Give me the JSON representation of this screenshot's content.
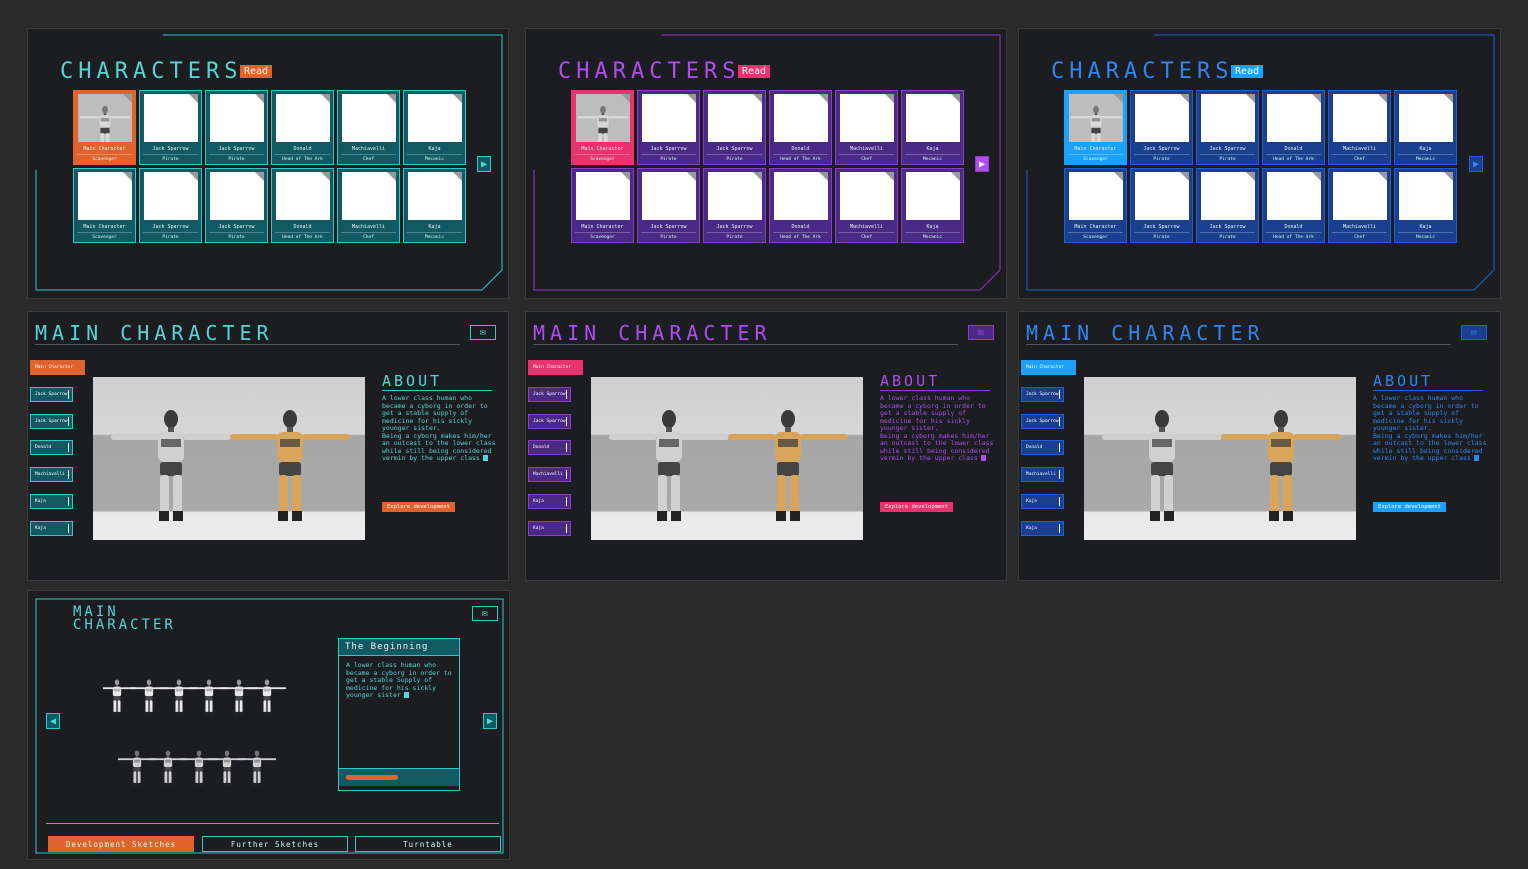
{
  "characters_screen": {
    "title": "CHARACTERS",
    "read_badge": "Read",
    "cards": [
      {
        "name": "Main Character",
        "role": "Scavenger"
      },
      {
        "name": "Jack Sparrow",
        "role": "Pirate"
      },
      {
        "name": "Jack Sparrow",
        "role": "Pirate"
      },
      {
        "name": "Donald",
        "role": "Head of The Ark"
      },
      {
        "name": "Machiavelli",
        "role": "Chef"
      },
      {
        "name": "Kaja",
        "role": "Mecanic"
      },
      {
        "name": "Main Character",
        "role": "Scavenger"
      },
      {
        "name": "Jack Sparrow",
        "role": "Pirate"
      },
      {
        "name": "Jack Sparrow",
        "role": "Pirate"
      },
      {
        "name": "Donald",
        "role": "Head of The Ark"
      },
      {
        "name": "Machiavelli",
        "role": "Chef"
      },
      {
        "name": "Kaja",
        "role": "Mecanic"
      }
    ],
    "next_arrow": "▶"
  },
  "main_character_screen": {
    "title": "MAIN CHARACTER",
    "close_icon": "✉",
    "side_buttons": [
      "Main Character",
      "Jack Sparrow",
      "Jack Sparrow",
      "Donald",
      "Machiavelli",
      "Kaja",
      "Kaja"
    ],
    "about_heading": "ABOUT",
    "about_text": "A lower class human who became a cyborg in order to get a stable supply of medicine for his sickly younger sister.\nBeing a cyborg makes him/her an outcast to the lower class while still being considered vermin by the upper class",
    "explore_button": "Explore development"
  },
  "sketch_screen": {
    "title_line1": "MAIN",
    "title_line2": "CHARACTER",
    "close_icon": "✉",
    "info_heading": "The Beginning",
    "info_text": "A lower class human who became a cyborg in order to get a stable Supply of medicine for his sickly younger sister",
    "prev_arrow": "◀",
    "next_arrow": "▶",
    "tabs": [
      "Development Sketches",
      "Further Sketches",
      "Turntable"
    ]
  },
  "themes": {
    "teal": {
      "accent": "#e0632e",
      "line": "#2fc7c7",
      "card": "#125a63",
      "title": "#54d6d6"
    },
    "purple": {
      "accent": "#e8336f",
      "line": "#8f3ac8",
      "card": "#4a2a86",
      "title": "#b04cf0"
    },
    "blue": {
      "accent": "#1da1ff",
      "line": "#1f5ed6",
      "card": "#1a3f8f",
      "title": "#2f86f0"
    }
  }
}
